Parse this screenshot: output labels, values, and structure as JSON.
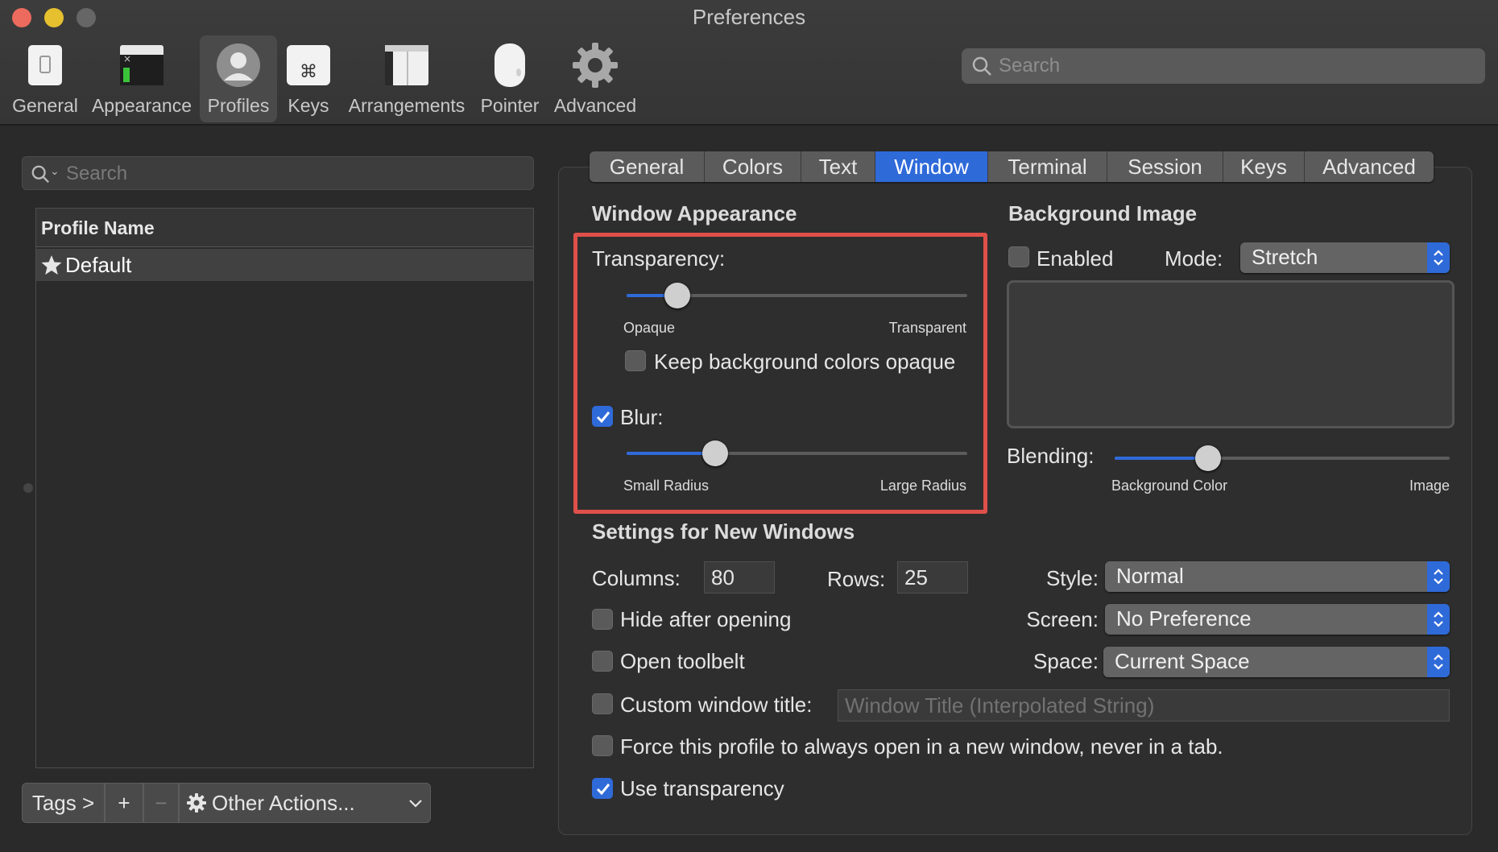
{
  "window": {
    "title": "Preferences",
    "traffic_colors": {
      "close": "#ed6a5e",
      "minimize": "#e6c02f",
      "zoom": "#666666"
    }
  },
  "toolbar": {
    "items": [
      {
        "label": "General",
        "icon": "general-switch-icon",
        "selected": false
      },
      {
        "label": "Appearance",
        "icon": "appearance-window-icon",
        "selected": false
      },
      {
        "label": "Profiles",
        "icon": "profile-user-icon",
        "selected": true
      },
      {
        "label": "Keys",
        "icon": "command-key-icon",
        "selected": false
      },
      {
        "label": "Arrangements",
        "icon": "arrangements-windows-icon",
        "selected": false
      },
      {
        "label": "Pointer",
        "icon": "mouse-icon",
        "selected": false
      },
      {
        "label": "Advanced",
        "icon": "gear-icon",
        "selected": false
      }
    ],
    "search_placeholder": "Search"
  },
  "profiles": {
    "search_placeholder": "Search",
    "column_header": "Profile Name",
    "rows": [
      {
        "name": "Default",
        "icon": "star-icon",
        "selected": true
      }
    ],
    "bottom_bar": {
      "tags": "Tags >",
      "add": "+",
      "remove": "−",
      "other_actions": "Other Actions..."
    }
  },
  "tabs": {
    "items": [
      "General",
      "Colors",
      "Text",
      "Window",
      "Terminal",
      "Session",
      "Keys",
      "Advanced"
    ],
    "active": "Window"
  },
  "window_appearance": {
    "title": "Window Appearance",
    "transparency_label": "Transparency:",
    "transparency_value": 0.15,
    "transparency_min": "Opaque",
    "transparency_max": "Transparent",
    "keep_bg_opaque_label": "Keep background colors opaque",
    "keep_bg_opaque_checked": false,
    "blur_label": "Blur:",
    "blur_checked": true,
    "blur_value": 0.26,
    "blur_min": "Small Radius",
    "blur_max": "Large Radius"
  },
  "background_image": {
    "title": "Background Image",
    "enabled_label": "Enabled",
    "enabled_checked": false,
    "mode_label": "Mode:",
    "mode_value": "Stretch",
    "blending_label": "Blending:",
    "blending_value": 0.28,
    "blending_min": "Background Color",
    "blending_max": "Image"
  },
  "new_windows": {
    "title": "Settings for New Windows",
    "columns_label": "Columns:",
    "columns_value": "80",
    "rows_label": "Rows:",
    "rows_value": "25",
    "style_label": "Style:",
    "style_value": "Normal",
    "screen_label": "Screen:",
    "screen_value": "No Preference",
    "space_label": "Space:",
    "space_value": "Current Space",
    "hide_after_opening": {
      "label": "Hide after opening",
      "checked": false
    },
    "open_toolbelt": {
      "label": "Open toolbelt",
      "checked": false
    },
    "custom_title": {
      "label": "Custom window title:",
      "checked": false,
      "placeholder": "Window Title (Interpolated String)"
    },
    "force_new_window": {
      "label": "Force this profile to always open in a new window, never in a tab.",
      "checked": false
    },
    "use_transparency": {
      "label": "Use transparency",
      "checked": true
    }
  },
  "colors": {
    "accent": "#2f6ad9",
    "highlight_border": "#e0504a"
  }
}
